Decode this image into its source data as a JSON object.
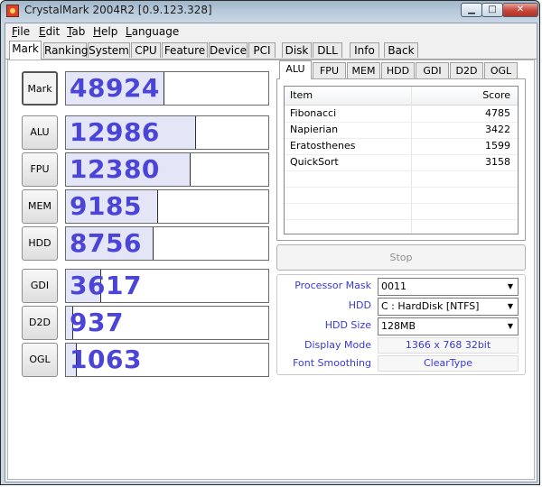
{
  "window": {
    "title": "CrystalMark 2004R2 [0.9.123.328]",
    "minimize_glyph": "▁",
    "maximize_glyph": "□",
    "close_glyph": "✕"
  },
  "menu": [
    {
      "underline": "F",
      "rest": "ile"
    },
    {
      "underline": "E",
      "rest": "dit"
    },
    {
      "underline": "T",
      "rest": "ab"
    },
    {
      "underline": "H",
      "rest": "elp"
    },
    {
      "underline": "L",
      "rest": "anguage"
    }
  ],
  "tabs": [
    "Mark",
    "Ranking",
    "System",
    "CPU",
    "Feature",
    "Device",
    "PCI",
    "Disk",
    "DLL",
    "Info",
    "Back"
  ],
  "active_tab": "Mark",
  "scores": [
    {
      "label": "Mark",
      "value": "48924",
      "bar_fraction": 0.48
    },
    {
      "label": "ALU",
      "value": "12986",
      "bar_fraction": 0.64
    },
    {
      "label": "FPU",
      "value": "12380",
      "bar_fraction": 0.61
    },
    {
      "label": "MEM",
      "value": "9185",
      "bar_fraction": 0.45
    },
    {
      "label": "HDD",
      "value": "8756",
      "bar_fraction": 0.43
    },
    {
      "label": "GDI",
      "value": "3617",
      "bar_fraction": 0.17
    },
    {
      "label": "D2D",
      "value": "937",
      "bar_fraction": 0.03
    },
    {
      "label": "OGL",
      "value": "1063",
      "bar_fraction": 0.05
    }
  ],
  "subtabs": [
    "ALU",
    "FPU",
    "MEM",
    "HDD",
    "GDI",
    "D2D",
    "OGL"
  ],
  "active_subtab": "ALU",
  "results_table": {
    "headers": [
      "Item",
      "Score"
    ],
    "rows": [
      [
        "Fibonacci",
        "4785"
      ],
      [
        "Napierian",
        "3422"
      ],
      [
        "Eratosthenes",
        "1599"
      ],
      [
        "QuickSort",
        "3158"
      ]
    ]
  },
  "stop_label": "Stop",
  "settings": {
    "processor_mask": {
      "label": "Processor Mask",
      "value": "0011"
    },
    "hdd": {
      "label": "HDD",
      "value": "C : HardDisk [NTFS]"
    },
    "hdd_size": {
      "label": "HDD Size",
      "value": "128MB"
    },
    "display_mode": {
      "label": "Display Mode",
      "value": "1366 x 768 32bit"
    },
    "font_smoothing": {
      "label": "Font Smoothing",
      "value": "ClearType"
    }
  },
  "combo_arrow_glyph": "▼",
  "colors": {
    "score_text": "#4a45d8",
    "label_text": "#3a3ad0",
    "bar_fill": "#e4e6f7"
  }
}
